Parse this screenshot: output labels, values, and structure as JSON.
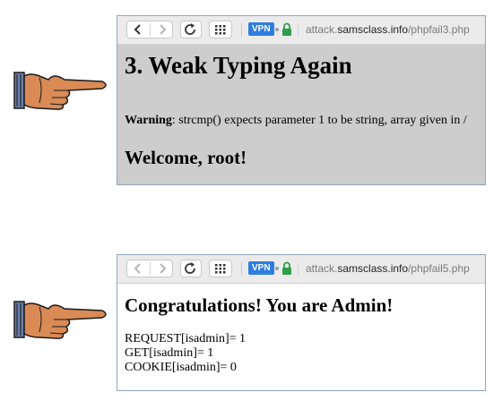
{
  "browser_top": {
    "vpn_label": "VPN",
    "url_prefix": "attack.",
    "url_domain": "samsclass.info",
    "url_path": "/phpfail3.php",
    "heading": "3. Weak Typing Again",
    "warning_label": "Warning",
    "warning_text": ": strcmp() expects parameter 1 to be string, array given in /",
    "welcome": "Welcome, root!"
  },
  "browser_bottom": {
    "vpn_label": "VPN",
    "url_prefix": "attack.",
    "url_domain": "samsclass.info",
    "url_path": "/phpfail5.php",
    "heading": "Congratulations! You are Admin!",
    "lines": [
      "REQUEST[isadmin]= 1",
      "GET[isadmin]= 1",
      "COOKIE[isadmin]= 0"
    ]
  },
  "icons": {
    "pointer": "pointing-hand-icon",
    "back": "chevron-left-icon",
    "forward": "chevron-right-icon",
    "reload": "reload-icon",
    "grid": "grid-icon",
    "lock": "lock-icon"
  },
  "colors": {
    "vpn_badge": "#2f7de1",
    "lock": "#2e9e4a",
    "top_page_bg": "#cdcdcd",
    "browser_border": "#8fa6bf"
  }
}
